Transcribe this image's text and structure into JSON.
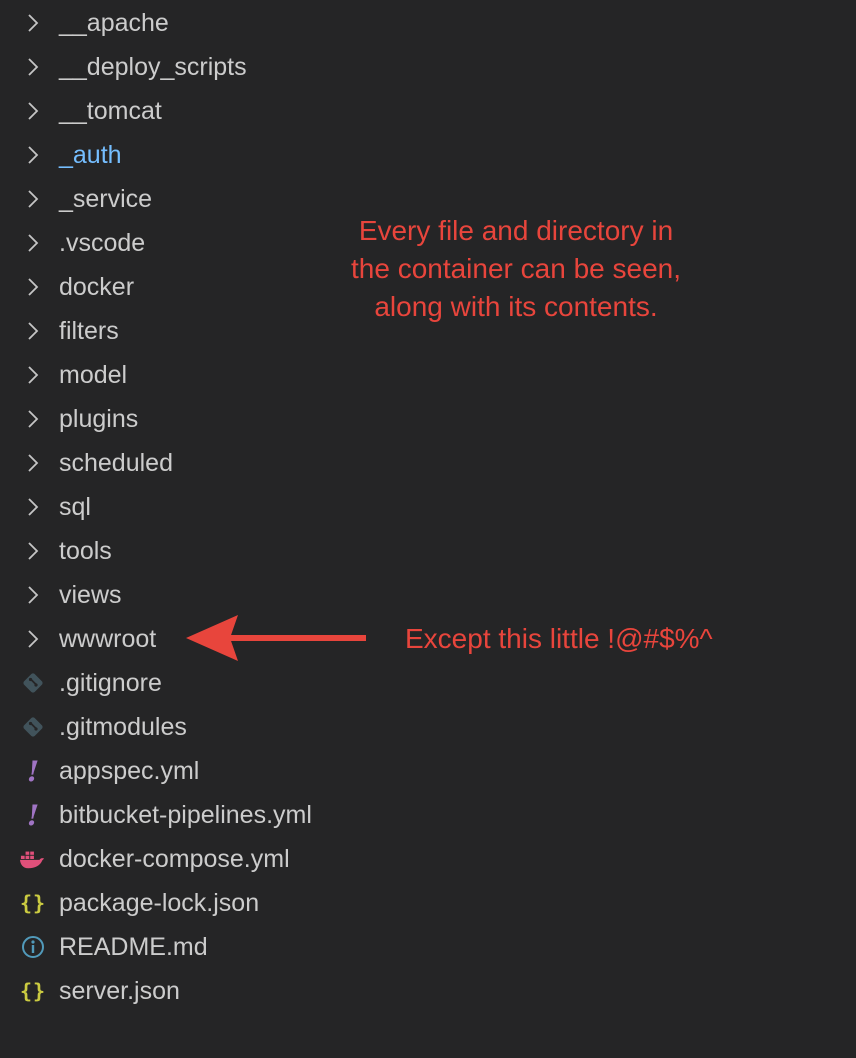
{
  "explorer": {
    "items": [
      {
        "label": "__apache",
        "kind": "folder",
        "icon": "chevron-right-icon"
      },
      {
        "label": "__deploy_scripts",
        "kind": "folder",
        "icon": "chevron-right-icon"
      },
      {
        "label": "__tomcat",
        "kind": "folder",
        "icon": "chevron-right-icon"
      },
      {
        "label": "_auth",
        "kind": "folder",
        "icon": "chevron-right-icon",
        "color": "#75beff"
      },
      {
        "label": "_service",
        "kind": "folder",
        "icon": "chevron-right-icon"
      },
      {
        "label": ".vscode",
        "kind": "folder",
        "icon": "chevron-right-icon"
      },
      {
        "label": "docker",
        "kind": "folder",
        "icon": "chevron-right-icon"
      },
      {
        "label": "filters",
        "kind": "folder",
        "icon": "chevron-right-icon"
      },
      {
        "label": "model",
        "kind": "folder",
        "icon": "chevron-right-icon"
      },
      {
        "label": "plugins",
        "kind": "folder",
        "icon": "chevron-right-icon"
      },
      {
        "label": "scheduled",
        "kind": "folder",
        "icon": "chevron-right-icon"
      },
      {
        "label": "sql",
        "kind": "folder",
        "icon": "chevron-right-icon"
      },
      {
        "label": "tools",
        "kind": "folder",
        "icon": "chevron-right-icon"
      },
      {
        "label": "views",
        "kind": "folder",
        "icon": "chevron-right-icon"
      },
      {
        "label": "wwwroot",
        "kind": "folder",
        "icon": "chevron-right-icon"
      },
      {
        "label": ".gitignore",
        "kind": "file",
        "icon": "git-icon"
      },
      {
        "label": ".gitmodules",
        "kind": "file",
        "icon": "git-icon"
      },
      {
        "label": "appspec.yml",
        "kind": "file",
        "icon": "yaml-icon"
      },
      {
        "label": "bitbucket-pipelines.yml",
        "kind": "file",
        "icon": "yaml-icon"
      },
      {
        "label": "docker-compose.yml",
        "kind": "file",
        "icon": "docker-icon"
      },
      {
        "label": "package-lock.json",
        "kind": "file",
        "icon": "json-icon"
      },
      {
        "label": "README.md",
        "kind": "file",
        "icon": "info-icon"
      },
      {
        "label": "server.json",
        "kind": "file",
        "icon": "json-icon"
      }
    ]
  },
  "annotations": {
    "top_lines": [
      "Every file and directory in",
      "the container can be seen,",
      "along with its contents."
    ],
    "bottom": "Except this little !@#$%^",
    "arrow_color": "#e8453c"
  },
  "colors": {
    "background": "#252526",
    "text": "#cccccc",
    "modified_folder": "#75beff",
    "annotation": "#e8453c",
    "git_icon": "#41535b",
    "yaml_icon": "#a074c4",
    "docker_icon": "#e0507a",
    "json_icon": "#cbcb41",
    "info_icon": "#519aba"
  }
}
